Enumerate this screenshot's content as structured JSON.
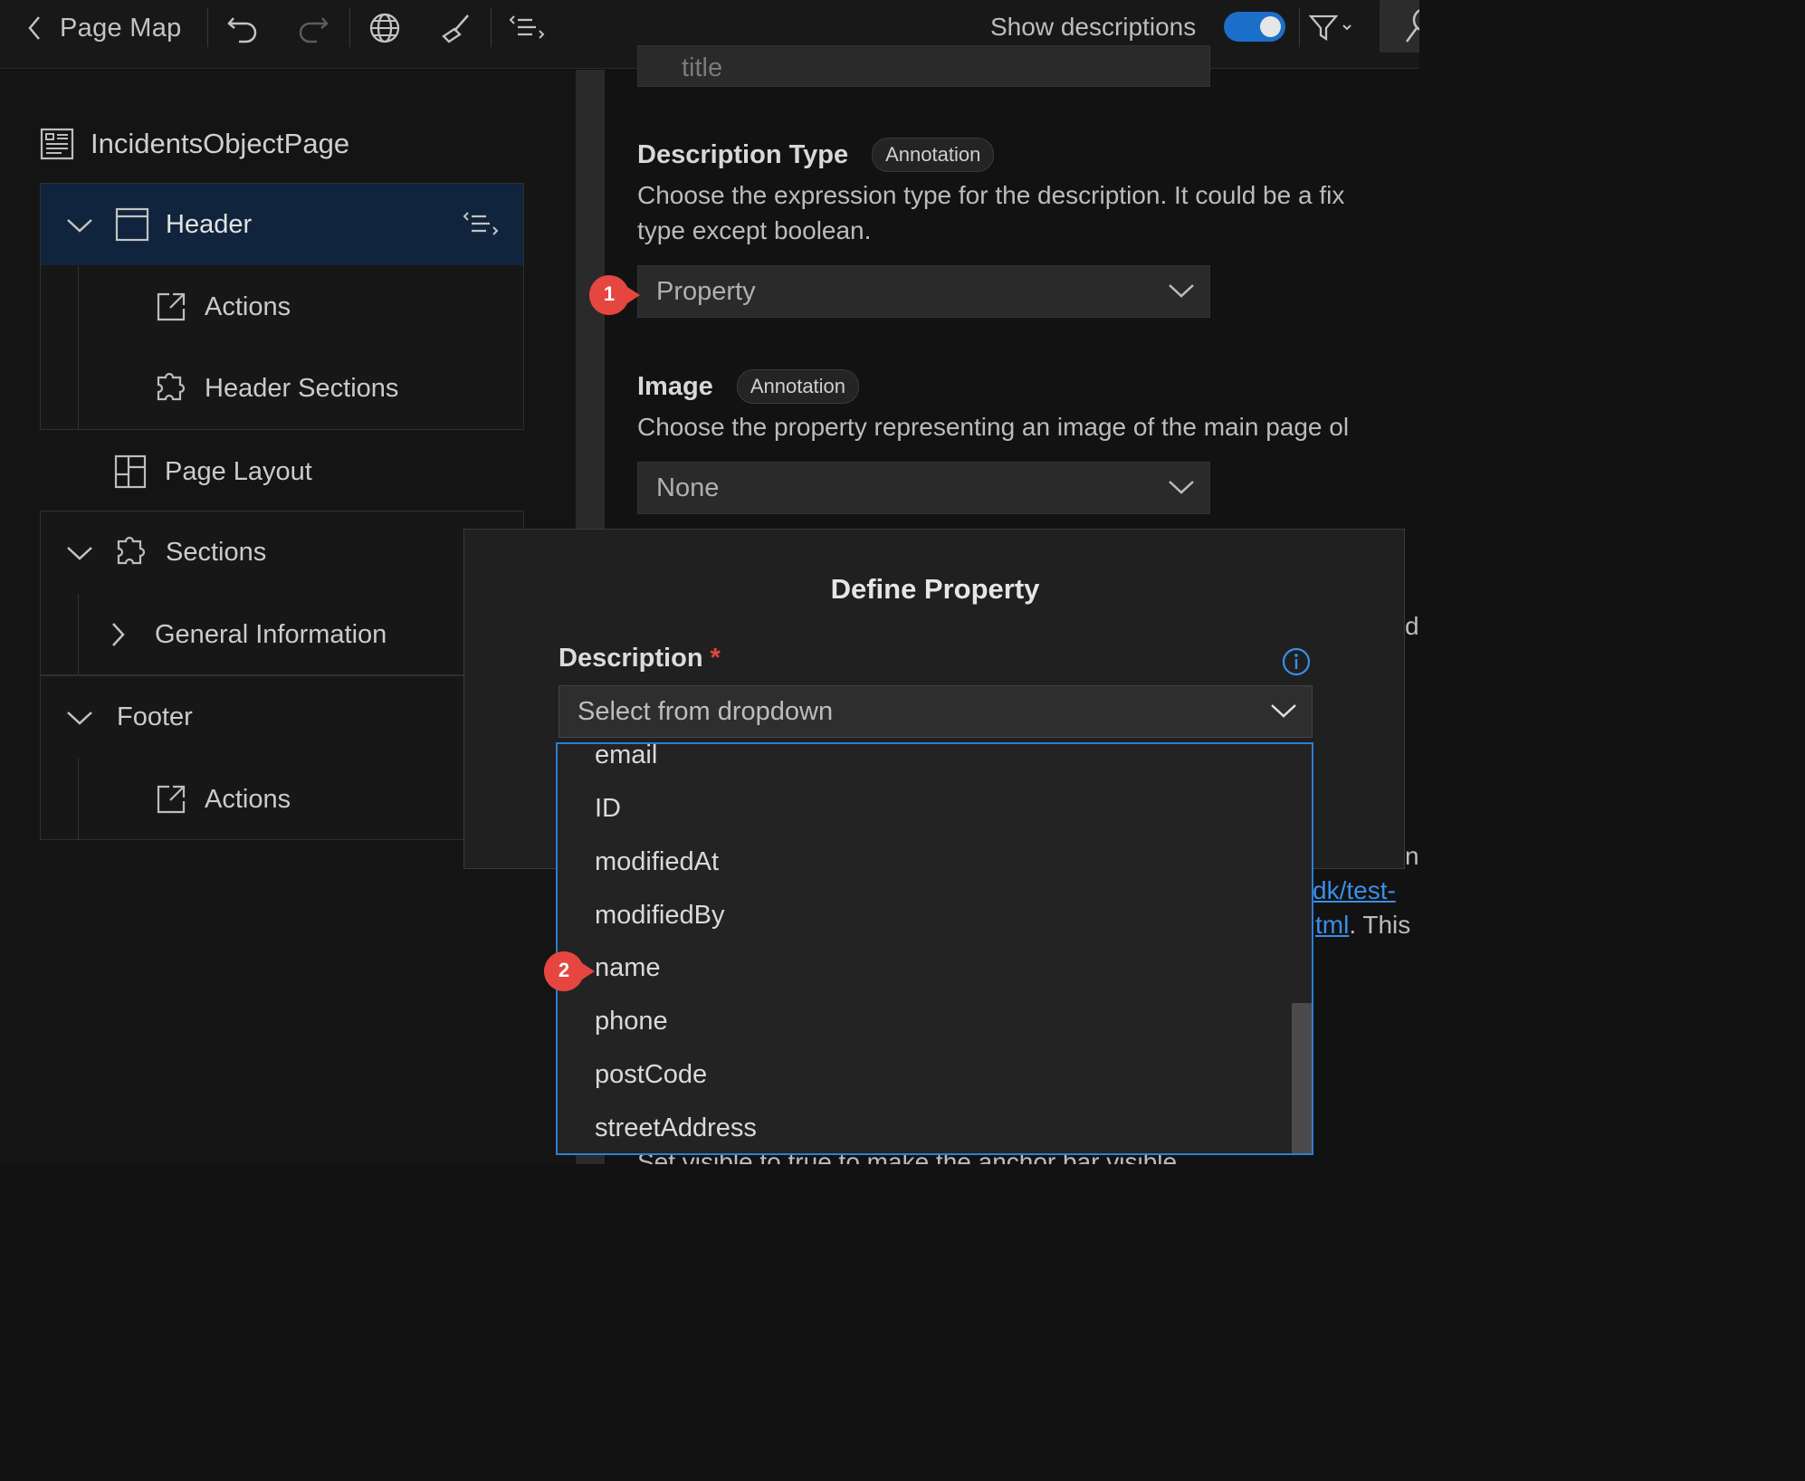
{
  "toolbar": {
    "back_label": "Page Map",
    "show_descriptions_label": "Show descriptions",
    "show_descriptions_on": true
  },
  "page_map": {
    "root_label": "IncidentsObjectPage",
    "header": {
      "label": "Header",
      "children": [
        "Actions",
        "Header Sections"
      ]
    },
    "page_layout_label": "Page Layout",
    "sections": {
      "label": "Sections",
      "children": [
        "General Information"
      ]
    },
    "footer": {
      "label": "Footer",
      "children": [
        "Actions"
      ]
    }
  },
  "properties": {
    "top_field_value": "title",
    "description_type": {
      "title": "Description Type",
      "chip": "Annotation",
      "desc_line1": "Choose the expression type for the description. It could be a fix",
      "desc_line2": "type except boolean.",
      "value": "Property"
    },
    "image": {
      "title": "Image",
      "chip": "Annotation",
      "desc_line1": "Choose the property representing an image of the main page ol",
      "value": "None"
    },
    "partial_texts": {
      "right_edge_1": "d",
      "right_edge_2": "n",
      "link_1": "dk/test-",
      "link_2": "tml",
      "after_link": ". This",
      "bottom_text": "Set visible to true to make the anchor bar visible."
    }
  },
  "dialog": {
    "title": "Define Property",
    "field_label": "Description",
    "required_mark": "*",
    "placeholder": "Select from dropdown",
    "options": [
      "email",
      "ID",
      "modifiedAt",
      "modifiedBy",
      "name",
      "phone",
      "postCode",
      "streetAddress"
    ]
  },
  "callouts": {
    "first": "1",
    "second": "2"
  },
  "colors": {
    "accent": "#2c7fd3",
    "callout": "#e5463f",
    "selected_row": "#10253d"
  }
}
